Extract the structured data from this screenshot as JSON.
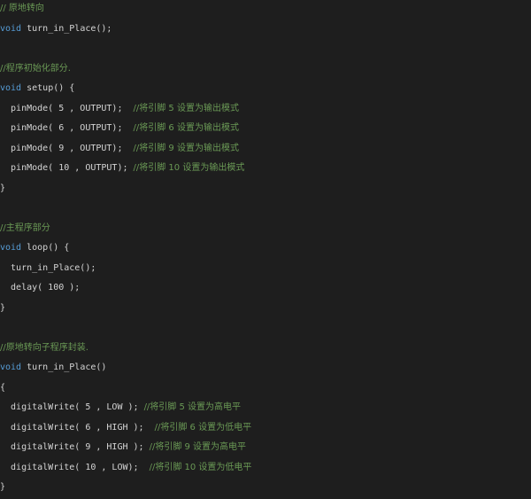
{
  "code": {
    "lines": [
      [
        {
          "text": "// 原地转向",
          "type": "comment"
        }
      ],
      [
        {
          "text": "void",
          "type": "keyword"
        },
        {
          "text": " turn_in_Place();",
          "type": "plain"
        }
      ],
      [],
      [
        {
          "text": "//程序初始化部分.",
          "type": "comment"
        }
      ],
      [
        {
          "text": "void",
          "type": "keyword"
        },
        {
          "text": " setup() {",
          "type": "plain"
        }
      ],
      [
        {
          "text": "  pinMode( 5 , OUTPUT);  ",
          "type": "plain"
        },
        {
          "text": "//将引脚 5 设置为输出模式",
          "type": "comment"
        }
      ],
      [
        {
          "text": "  pinMode( 6 , OUTPUT);  ",
          "type": "plain"
        },
        {
          "text": "//将引脚 6 设置为输出模式",
          "type": "comment"
        }
      ],
      [
        {
          "text": "  pinMode( 9 , OUTPUT);  ",
          "type": "plain"
        },
        {
          "text": "//将引脚 9 设置为输出模式",
          "type": "comment"
        }
      ],
      [
        {
          "text": "  pinMode( 10 , OUTPUT); ",
          "type": "plain"
        },
        {
          "text": "//将引脚 10 设置为输出模式",
          "type": "comment"
        }
      ],
      [
        {
          "text": "}",
          "type": "plain"
        }
      ],
      [],
      [
        {
          "text": "//主程序部分",
          "type": "comment"
        }
      ],
      [
        {
          "text": "void",
          "type": "keyword"
        },
        {
          "text": " loop() {",
          "type": "plain"
        }
      ],
      [
        {
          "text": "  turn_in_Place();",
          "type": "plain"
        }
      ],
      [
        {
          "text": "  delay( 100 );",
          "type": "plain"
        }
      ],
      [
        {
          "text": "}",
          "type": "plain"
        }
      ],
      [],
      [
        {
          "text": "//原地转向子程序封装.",
          "type": "comment"
        }
      ],
      [
        {
          "text": "void",
          "type": "keyword"
        },
        {
          "text": " turn_in_Place()",
          "type": "plain"
        }
      ],
      [
        {
          "text": "{",
          "type": "plain"
        }
      ],
      [
        {
          "text": "  digitalWrite( 5 , LOW ); ",
          "type": "plain"
        },
        {
          "text": "//将引脚 5 设置为高电平",
          "type": "comment"
        }
      ],
      [
        {
          "text": "  digitalWrite( 6 , HIGH );  ",
          "type": "plain"
        },
        {
          "text": "//将引脚 6 设置为低电平",
          "type": "comment"
        }
      ],
      [
        {
          "text": "  digitalWrite( 9 , HIGH ); ",
          "type": "plain"
        },
        {
          "text": "//将引脚 9 设置为高电平",
          "type": "comment"
        }
      ],
      [
        {
          "text": "  digitalWrite( 10 , LOW);  ",
          "type": "plain"
        },
        {
          "text": "//将引脚 10 设置为低电平",
          "type": "comment"
        }
      ],
      [
        {
          "text": "}",
          "type": "plain"
        }
      ]
    ]
  },
  "colors": {
    "background": "#1e1e1e",
    "comment": "#6a9955",
    "keyword": "#569cd6",
    "text": "#d4d4d4"
  }
}
